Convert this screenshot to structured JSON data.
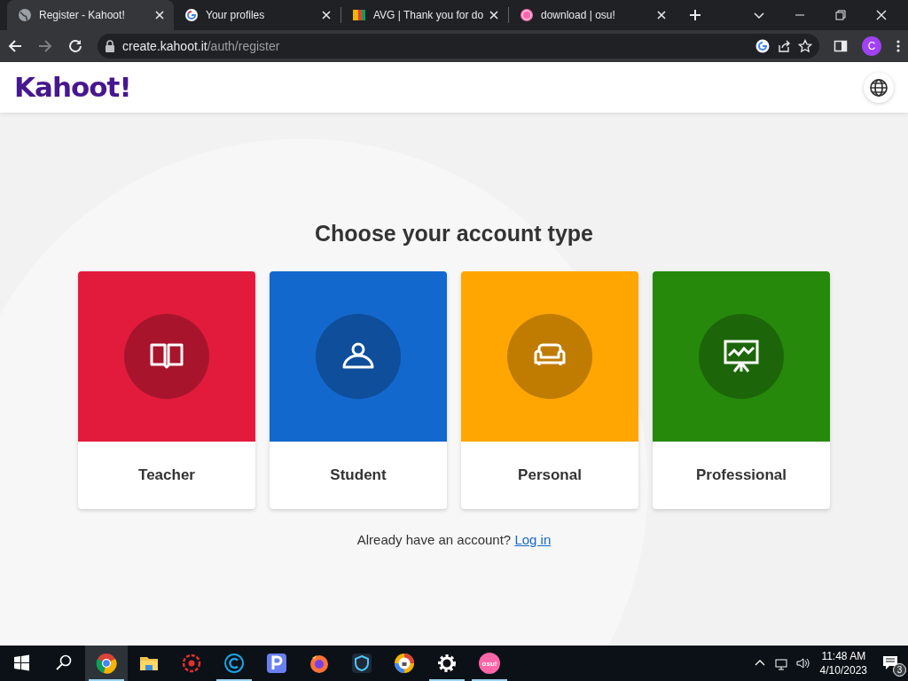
{
  "browser": {
    "tabs": [
      {
        "title": "Register - Kahoot!",
        "kind": "globe",
        "selected": true
      },
      {
        "title": "Your profiles",
        "kind": "google",
        "selected": false
      },
      {
        "title": "AVG | Thank you for do",
        "kind": "avg",
        "selected": false
      },
      {
        "title": "download | osu!",
        "kind": "osu",
        "selected": false
      }
    ],
    "address": {
      "host": "create.kahoot.it",
      "path": "/auth/register"
    },
    "profile": "C"
  },
  "header": {
    "logo": "Kahoot!"
  },
  "page": {
    "title": "Choose your account type",
    "cards": [
      {
        "label": "Teacher",
        "kind": "book",
        "color": "#e21b3c"
      },
      {
        "label": "Student",
        "kind": "person",
        "color": "#1368ce"
      },
      {
        "label": "Personal",
        "kind": "sofa",
        "color": "#ffa602"
      },
      {
        "label": "Professional",
        "kind": "presentation",
        "color": "#26890c"
      }
    ],
    "login_prompt": "Already have an account?",
    "login_link": "Log in"
  },
  "taskbar": {
    "apps": [
      {
        "kind": "chrome",
        "running": true,
        "selected": true
      },
      {
        "kind": "folder",
        "running": false,
        "selected": false
      },
      {
        "kind": "redgear",
        "running": false,
        "selected": false
      },
      {
        "kind": "copyright",
        "running": true,
        "selected": false
      },
      {
        "kind": "p",
        "running": false,
        "selected": false
      },
      {
        "kind": "firefox",
        "running": false,
        "selected": false
      },
      {
        "kind": "shield",
        "running": false,
        "selected": false
      },
      {
        "kind": "lockbrowser",
        "running": false,
        "selected": false
      },
      {
        "kind": "gear",
        "running": true,
        "selected": false
      },
      {
        "kind": "osu",
        "running": true,
        "selected": false,
        "label": "osu!"
      }
    ],
    "time": "11:48 AM",
    "date": "4/10/2023",
    "notifications": "3"
  }
}
